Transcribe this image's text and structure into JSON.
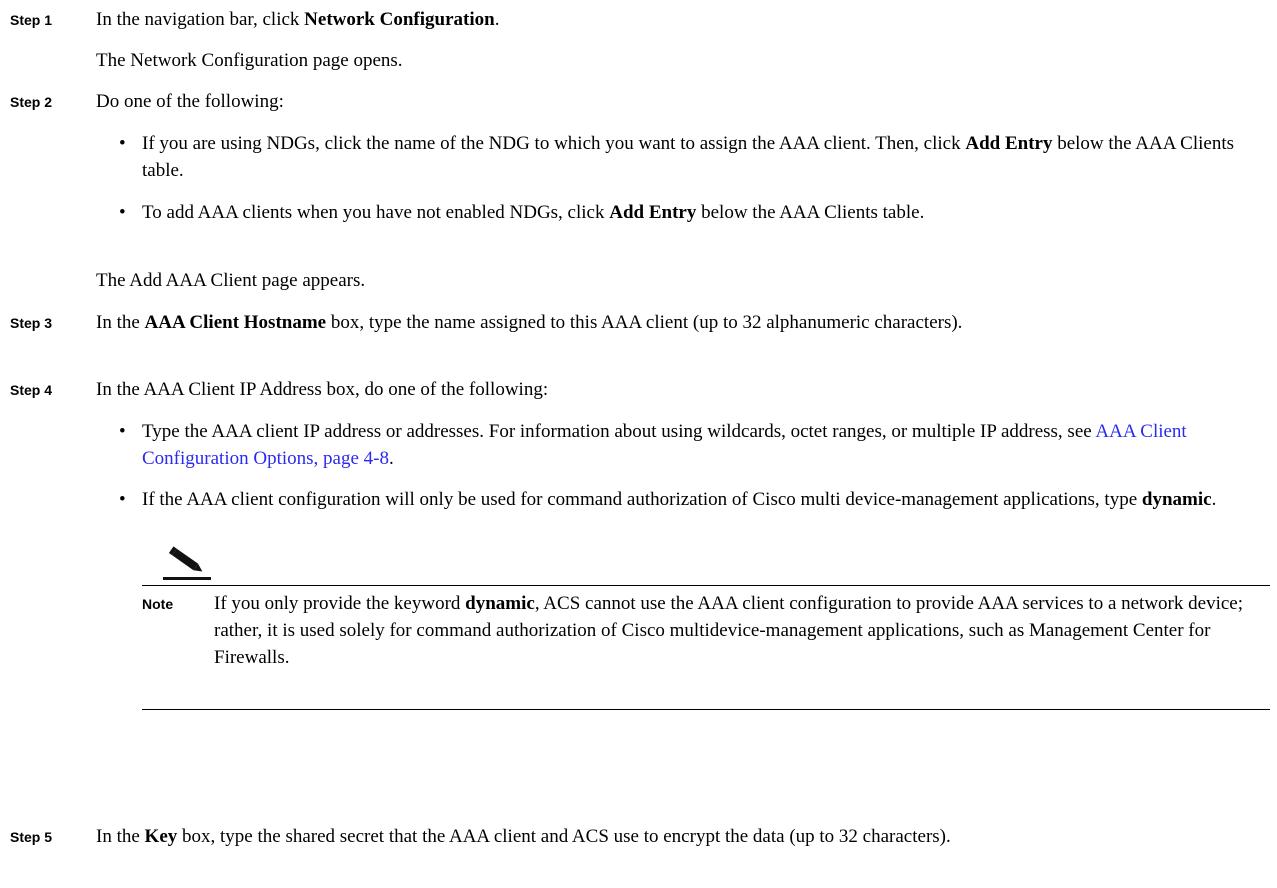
{
  "steps": [
    {
      "label": "Step 1",
      "pre": "In the navigation bar, click ",
      "bold": "Network Configuration",
      "post": ".",
      "result": "The Network Configuration page opens."
    },
    {
      "label": "Step 2",
      "text": "Do one of the following:",
      "bullets": [
        {
          "pre": "If you are using NDGs, click the name of the NDG to which you want to assign the AAA client. Then, click ",
          "bold": "Add Entry",
          "post": " below the AAA Clients table."
        },
        {
          "pre": "To add AAA clients when you have not enabled NDGs, click ",
          "bold": "Add Entry",
          "post": " below the AAA Clients table."
        }
      ],
      "result": "The Add AAA Client page appears."
    },
    {
      "label": "Step 3",
      "pre": "In the ",
      "bold": "AAA Client Hostname",
      "post": " box, type the name assigned to this AAA client (up to 32 alphanumeric characters)."
    },
    {
      "label": "Step 4",
      "text": "In the AAA Client IP Address box, do one of the following:",
      "bullets": [
        {
          "pre": "Type the AAA client IP address or addresses. For information about using wildcards, octet ranges, or multiple IP address, see ",
          "link": "AAA Client Configuration Options, page 4-8",
          "post": "."
        },
        {
          "pre": "If the AAA client configuration will only be used for command authorization of Cisco multi device-management applications, type ",
          "bold": "dynamic",
          "post": "."
        }
      ]
    },
    {
      "label": "Step 5",
      "pre": "In the ",
      "bold": "Key",
      "post": " box, type the shared secret that the AAA client and ACS use to encrypt the data (up to 32 characters)."
    }
  ],
  "bullet_char": "•",
  "note": {
    "label": "Note",
    "icon": "pencil-note-icon",
    "pre": "If you only provide the keyword ",
    "bold": "dynamic",
    "post": ", ACS cannot use the AAA client configuration to provide AAA services to a network device; rather, it is used solely for command authorization of Cisco multidevice-management applications, such as Management Center for Firewalls."
  }
}
